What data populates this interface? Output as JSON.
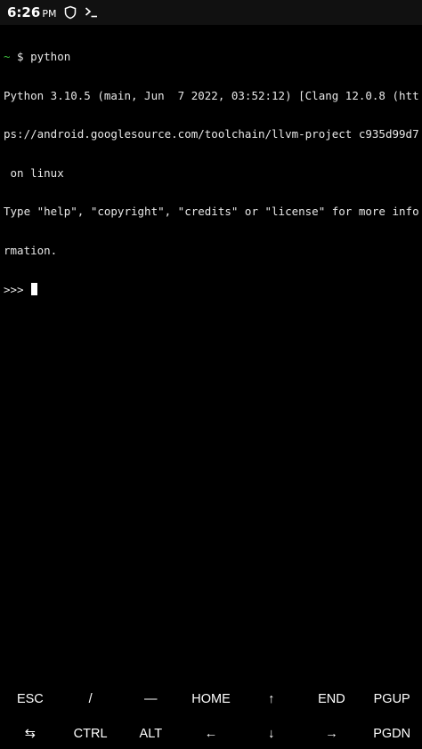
{
  "status_bar": {
    "time": "6:26",
    "ampm": "PM",
    "icons": [
      "shield-icon",
      "terminal-icon"
    ]
  },
  "terminal": {
    "prompt_symbol": "~",
    "prompt_command": " $ python",
    "lines": [
      "Python 3.10.5 (main, Jun  7 2022, 03:52:12) [Clang 12.0.8 (htt",
      "ps://android.googlesource.com/toolchain/llvm-project c935d99d7",
      " on linux",
      "Type \"help\", \"copyright\", \"credits\" or \"license\" for more info",
      "rmation."
    ],
    "repl_prompt": ">>> "
  },
  "extra_keys": {
    "row1": [
      "ESC",
      "/",
      "—",
      "HOME",
      "↑",
      "END",
      "PGUP"
    ],
    "row2": [
      "⇆",
      "CTRL",
      "ALT",
      "←",
      "↓",
      "→",
      "PGDN"
    ]
  }
}
